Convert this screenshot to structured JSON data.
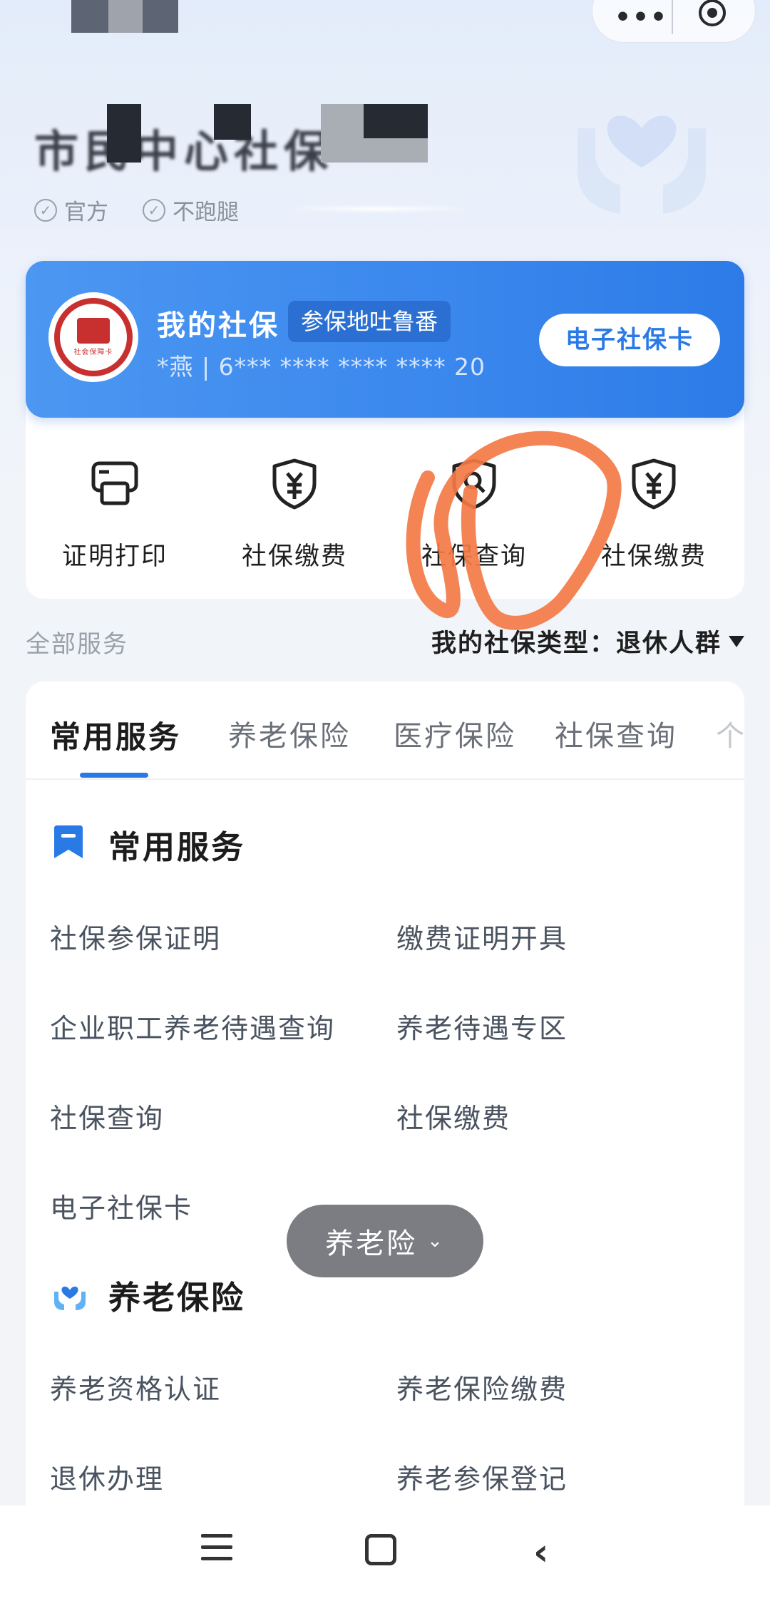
{
  "header": {
    "title": "市民中心社保",
    "tags": [
      "官方",
      "不跑腿"
    ],
    "menu_dots": "•••"
  },
  "card": {
    "title": "我的社保",
    "chip": "参保地吐鲁番",
    "number": "*燕 | 6*** **** **** **** 20",
    "badge_text": "社会保障卡",
    "ecard_button": "电子社保卡"
  },
  "quick_actions": [
    {
      "label": "证明打印",
      "icon": "printer-icon"
    },
    {
      "label": "社保缴费",
      "icon": "yuan-shield-icon"
    },
    {
      "label": "社保查询",
      "icon": "search-shield-icon"
    },
    {
      "label": "社保缴费",
      "icon": "yuan-shield-icon"
    }
  ],
  "services_bar": {
    "all_label": "全部服务",
    "type_label": "我的社保类型：退休人群"
  },
  "tabs": [
    "常用服务",
    "养老保险",
    "医疗保险",
    "社保查询",
    "个"
  ],
  "sections": [
    {
      "title": "常用服务",
      "items": [
        "社保参保证明",
        "缴费证明开具",
        "企业职工养老待遇查询",
        "养老待遇专区",
        "社保查询",
        "社保缴费",
        "电子社保卡"
      ]
    },
    {
      "title": "养老保险",
      "items": [
        "养老资格认证",
        "养老保险缴费",
        "退休办理",
        "养老参保登记"
      ]
    }
  ],
  "floating_pill": {
    "label": "养老险",
    "chevron": "⌄"
  },
  "nav": {
    "back": "‹"
  },
  "colors": {
    "accent": "#2a7ae6",
    "card": "#3b88ee",
    "annotation": "#f47a47"
  }
}
